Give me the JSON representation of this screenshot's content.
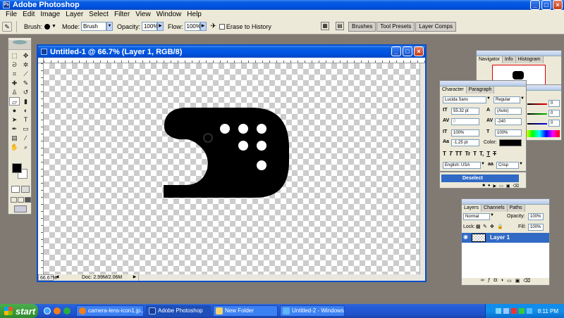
{
  "app": {
    "title": "Adobe Photoshop"
  },
  "menu": [
    "File",
    "Edit",
    "Image",
    "Layer",
    "Select",
    "Filter",
    "View",
    "Window",
    "Help"
  ],
  "options": {
    "brush_label": "Brush:",
    "mode_label": "Mode:",
    "mode_value": "Brush",
    "opacity_label": "Opacity:",
    "opacity_value": "100%",
    "flow_label": "Flow:",
    "flow_value": "100%",
    "erase_history_label": "Erase to History"
  },
  "palette_well": [
    "Brushes",
    "Tool Presets",
    "Layer Comps"
  ],
  "document": {
    "title": "Untitled-1 @ 66.7% (Layer 1, RGB/8)",
    "zoom": "66.67%",
    "doc_info": "Doc: 2.99M/2.06M"
  },
  "navigator": {
    "tabs": [
      "Navigator",
      "Info",
      "Histogram"
    ]
  },
  "color_palette": {
    "values": [
      "0",
      "0",
      "0"
    ]
  },
  "character": {
    "tabs": [
      "Character",
      "Paragraph"
    ],
    "font_family": "Lucida Sans",
    "font_style": "Regular",
    "font_size": "55.32 pt",
    "leading": "(Auto)",
    "kerning": "0",
    "tracking": "-240",
    "vert_scale": "100%",
    "horiz_scale": "100%",
    "baseline": "-1.25 pt",
    "color_label": "Color:",
    "style_buttons": [
      "T",
      "T",
      "TT",
      "Tr",
      "T",
      "T,",
      "T",
      "T"
    ],
    "language": "English: USA",
    "antialias_label": "aa",
    "antialias": "Crisp"
  },
  "actions": {
    "item": "Deselect"
  },
  "layers": {
    "tabs": [
      "Layers",
      "Channels",
      "Paths"
    ],
    "blend_mode": "Normal",
    "opacity_label": "Opacity:",
    "opacity_value": "100%",
    "lock_label": "Lock:",
    "fill_label": "Fill:",
    "fill_value": "100%",
    "layer_name": "Layer 1"
  },
  "taskbar": {
    "start": "start",
    "items": [
      "camera-lens-icon1.jp...",
      "Adobe Photoshop",
      "New Folder",
      "Untitled-2 - Windows ..."
    ],
    "clock": "8:11 PM"
  },
  "colors": {
    "xp_blue": "#0054e3",
    "taskbar_blue": "#245edb",
    "selected_layer": "#316ac5"
  }
}
